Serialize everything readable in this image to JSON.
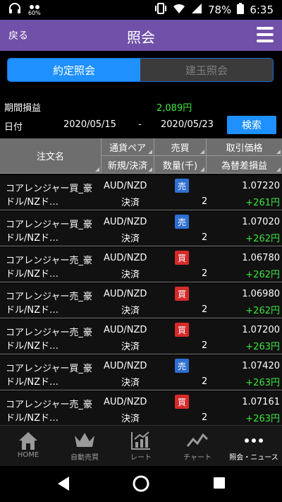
{
  "status": {
    "battery": "78%",
    "time": "6:35",
    "data_speed": "60%"
  },
  "header": {
    "back_label": "戻る",
    "title": "照会"
  },
  "tabs": [
    {
      "label": "約定照会",
      "active": true
    },
    {
      "label": "建玉照会",
      "active": false
    }
  ],
  "summary": {
    "pnl_label": "期間損益",
    "pnl_value": "2,089円",
    "date_label": "日付",
    "date_from": "2020/05/15",
    "date_sep": "-",
    "date_to": "2020/05/23",
    "search_label": "検索"
  },
  "table": {
    "headers": {
      "order_name": "注文名",
      "currency_pair": "通貨ペア",
      "side": "売買",
      "price": "取引価格",
      "new_settle": "新規/決済",
      "quantity": "数量(千)",
      "fx_pnl": "為替差損益"
    },
    "rows": [
      {
        "name1": "コアレンジャー買_豪",
        "name2": "ドル/NZド…",
        "pair": "AUD/NZD",
        "type": "決済",
        "side": "売",
        "qty": "2",
        "price": "1.07220",
        "pnl": "+261円"
      },
      {
        "name1": "コアレンジャー買_豪",
        "name2": "ドル/NZド…",
        "pair": "AUD/NZD",
        "type": "決済",
        "side": "売",
        "qty": "2",
        "price": "1.07020",
        "pnl": "+262円"
      },
      {
        "name1": "コアレンジャー売_豪",
        "name2": "ドル/NZド…",
        "pair": "AUD/NZD",
        "type": "決済",
        "side": "買",
        "qty": "2",
        "price": "1.06780",
        "pnl": "+262円"
      },
      {
        "name1": "コアレンジャー売_豪",
        "name2": "ドル/NZド…",
        "pair": "AUD/NZD",
        "type": "決済",
        "side": "買",
        "qty": "2",
        "price": "1.06980",
        "pnl": "+262円"
      },
      {
        "name1": "コアレンジャー売_豪",
        "name2": "ドル/NZド…",
        "pair": "AUD/NZD",
        "type": "決済",
        "side": "買",
        "qty": "2",
        "price": "1.07200",
        "pnl": "+263円"
      },
      {
        "name1": "コアレンジャー買_豪",
        "name2": "ドル/NZド…",
        "pair": "AUD/NZD",
        "type": "決済",
        "side": "売",
        "qty": "2",
        "price": "1.07420",
        "pnl": "+263円"
      },
      {
        "name1": "コアレンジャー売_豪",
        "name2": "ドル/NZド…",
        "pair": "AUD/NZD",
        "type": "決済",
        "side": "買",
        "qty": "2",
        "price": "1.07161",
        "pnl": "+263円"
      }
    ]
  },
  "bottom_nav": [
    {
      "label": "HOME",
      "icon": "home-icon"
    },
    {
      "label": "自動売買",
      "icon": "crown-icon"
    },
    {
      "label": "レート",
      "icon": "rate-chart-icon"
    },
    {
      "label": "チャート",
      "icon": "trend-line-icon"
    },
    {
      "label": "照会・ニュース",
      "icon": "more-dots-icon",
      "active": true
    }
  ],
  "colors": {
    "header": "#7050a8",
    "accent": "#1e90ff",
    "profit": "#3ee53e",
    "sell_badge": "#2e6fd1",
    "buy_badge": "#d52a2a"
  }
}
